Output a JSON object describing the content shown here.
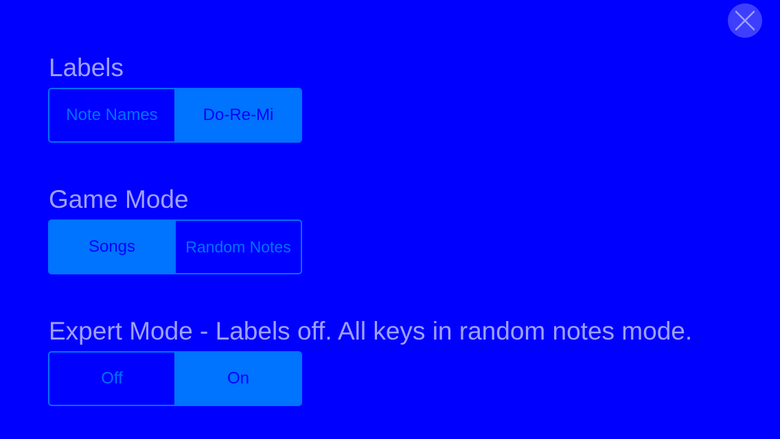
{
  "close_button": {
    "icon": "close-icon"
  },
  "labels": {
    "title": "Labels",
    "options": [
      {
        "label": "Note Names",
        "selected": false
      },
      {
        "label": "Do-Re-Mi",
        "selected": true
      }
    ]
  },
  "game_mode": {
    "title": "Game Mode",
    "options": [
      {
        "label": "Songs",
        "selected": true
      },
      {
        "label": "Random Notes",
        "selected": false
      }
    ]
  },
  "expert_mode": {
    "title": "Expert Mode - Labels off. All keys in random notes mode.",
    "options": [
      {
        "label": "Off",
        "selected": false
      },
      {
        "label": "On",
        "selected": true
      }
    ]
  },
  "colors": {
    "background": "#0000FF",
    "accent": "#0073FF",
    "label_text": "#9FA0FF",
    "close_button_bg": "#3E3EFF"
  }
}
